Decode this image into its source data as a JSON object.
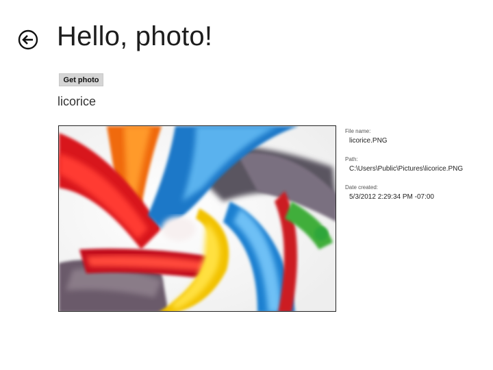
{
  "header": {
    "back_icon": "back-arrow-circle-icon",
    "title": "Hello, photo!"
  },
  "actions": {
    "get_photo_label": "Get photo"
  },
  "photo": {
    "title": "licorice"
  },
  "details": [
    {
      "label": "File name:",
      "value": "licorice.PNG"
    },
    {
      "label": "Path:",
      "value": "C:\\Users\\Public\\Pictures\\licorice.PNG"
    },
    {
      "label": "Date created:",
      "value": "5/3/2012 2:29:34 PM -07:00"
    }
  ]
}
